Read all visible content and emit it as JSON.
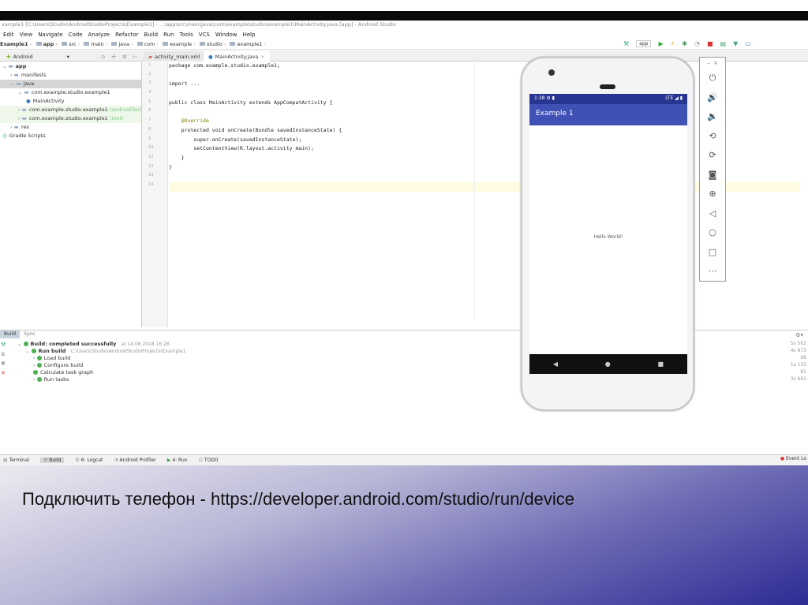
{
  "window": {
    "title": "xample1 [C:\\Users\\Studio\\AndroidStudioProjects\\Example1] - ...\\app\\src\\main\\java\\com\\example\\studio\\example1\\MainActivity.java [app] - Android Studio"
  },
  "menu": [
    "Edit",
    "View",
    "Navigate",
    "Code",
    "Analyze",
    "Refactor",
    "Build",
    "Run",
    "Tools",
    "VCS",
    "Window",
    "Help"
  ],
  "breadcrumb": [
    "Example1",
    "app",
    "src",
    "main",
    "java",
    "com",
    "example",
    "studio",
    "example1"
  ],
  "toolbar": {
    "config": "app"
  },
  "project": {
    "view": "Android",
    "tree": [
      {
        "label": "app",
        "indent": 0
      },
      {
        "label": "manifests",
        "indent": 1
      },
      {
        "label": "java",
        "indent": 1
      },
      {
        "label": "com.example.studio.example1",
        "indent": 2
      },
      {
        "label": "MainActivity",
        "indent": 3
      },
      {
        "label": "com.example.studio.example1",
        "suffix": "(androidTest)",
        "indent": 2
      },
      {
        "label": "com.example.studio.example1",
        "suffix": "(test)",
        "indent": 2
      },
      {
        "label": "res",
        "indent": 1
      },
      {
        "label": "Gradle Scripts",
        "indent": 0
      }
    ]
  },
  "editor_tabs": [
    "activity_main.xml",
    "MainActivity.java"
  ],
  "code": [
    "package com.example.studio.example1;",
    "",
    "import ...",
    "",
    "public class MainActivity extends AppCompatActivity {",
    "",
    "    @Override",
    "    protected void onCreate(Bundle savedInstanceState) {",
    "        super.onCreate(savedInstanceState);",
    "        setContentView(R.layout.activity_main);",
    "    }",
    "}",
    "",
    ""
  ],
  "build": {
    "tabs": [
      "Build",
      "Sync"
    ],
    "items": [
      {
        "label": "Build: completed successfully",
        "extra": "at 14.08.2018 16:26",
        "indent": 0
      },
      {
        "label": "Run build",
        "extra": "C:\\Users\\Studio\\AndroidStudioProjects\\Example1",
        "indent": 1
      },
      {
        "label": "Load build",
        "extra": "",
        "indent": 2
      },
      {
        "label": "Configure build",
        "extra": "",
        "indent": 2
      },
      {
        "label": "Calculate task graph",
        "extra": "",
        "indent": 2
      },
      {
        "label": "Run tasks",
        "extra": "",
        "indent": 2
      }
    ],
    "times": [
      "5s 562",
      "4s 973",
      "68",
      "1s 133",
      "81",
      "3s 661"
    ]
  },
  "bottom_tabs": [
    "Terminal",
    "Build",
    "6: Logcat",
    "Android Profiler",
    "4: Run",
    "TODO"
  ],
  "event_log": "Event Lo",
  "phone": {
    "time": "1:28",
    "network": "LTE",
    "app_title": "Example 1",
    "content": "Hello World!"
  },
  "emulator_controls": [
    "power-icon",
    "volume-up-icon",
    "volume-down-icon",
    "rotate-left-icon",
    "rotate-right-icon",
    "camera-icon",
    "zoom-icon",
    "back-icon",
    "home-icon",
    "overview-icon",
    "more-icon"
  ],
  "slide": {
    "caption": "Подключить телефон - https://developer.android.com/studio/run/device"
  },
  "colors": {
    "app_bar": "#3f51b5",
    "status_bar": "#283593",
    "slide_gradient_end": "#2c2c94"
  }
}
